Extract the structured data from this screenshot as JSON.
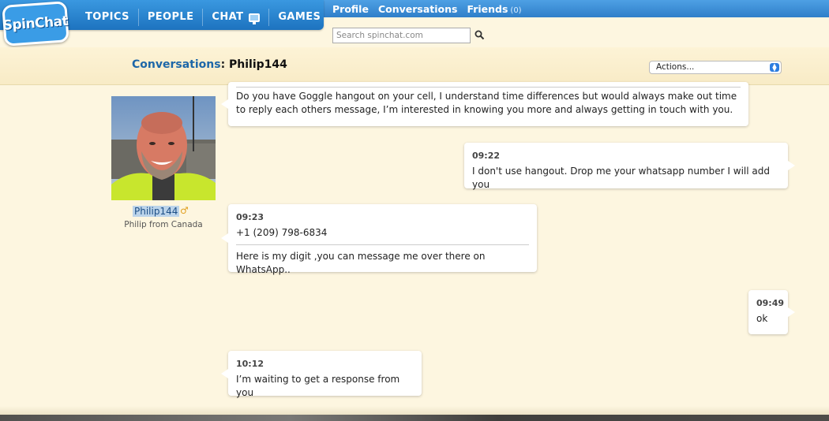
{
  "brand": {
    "logo_text": "SpinChat"
  },
  "main_nav": [
    {
      "label": "TOPICS"
    },
    {
      "label": "PEOPLE"
    },
    {
      "label": "CHAT"
    },
    {
      "label": "GAMES"
    }
  ],
  "sub_nav": {
    "profile": "Profile",
    "conversations": "Conversations",
    "friends": "Friends",
    "friends_count": "(0)"
  },
  "search": {
    "placeholder": "Search spinchat.com",
    "value": ""
  },
  "header": {
    "section_label": "Conversations",
    "colon": ":",
    "conversation_with": "Philip144",
    "actions_select": "Actions..."
  },
  "contact": {
    "username": "Philip144",
    "gender_symbol": "♂",
    "subtitle": "Philip from Canada"
  },
  "messages": [
    {
      "side": "left",
      "time": "",
      "text": "Do you have Goggle hangout on your cell, I understand time differences but would always make out time to reply each others message, I’m interested in knowing you more and always getting in touch with you."
    },
    {
      "side": "right",
      "time": "09:22",
      "text": "I don't use hangout. Drop me your whatsapp number I will add you"
    },
    {
      "side": "left",
      "time": "09:23",
      "text": "+1 (209) 798-6834",
      "text2": "Here is my digit ,you can message me over there on WhatsApp.."
    },
    {
      "side": "right",
      "time": "09:49",
      "text": "ok"
    },
    {
      "side": "left",
      "time": "10:12",
      "text": "I’m waiting to get a response from you"
    }
  ],
  "colors": {
    "nav_blue": "#1d73bf",
    "background": "#fdf6e0",
    "link_blue": "#1d67a8"
  }
}
